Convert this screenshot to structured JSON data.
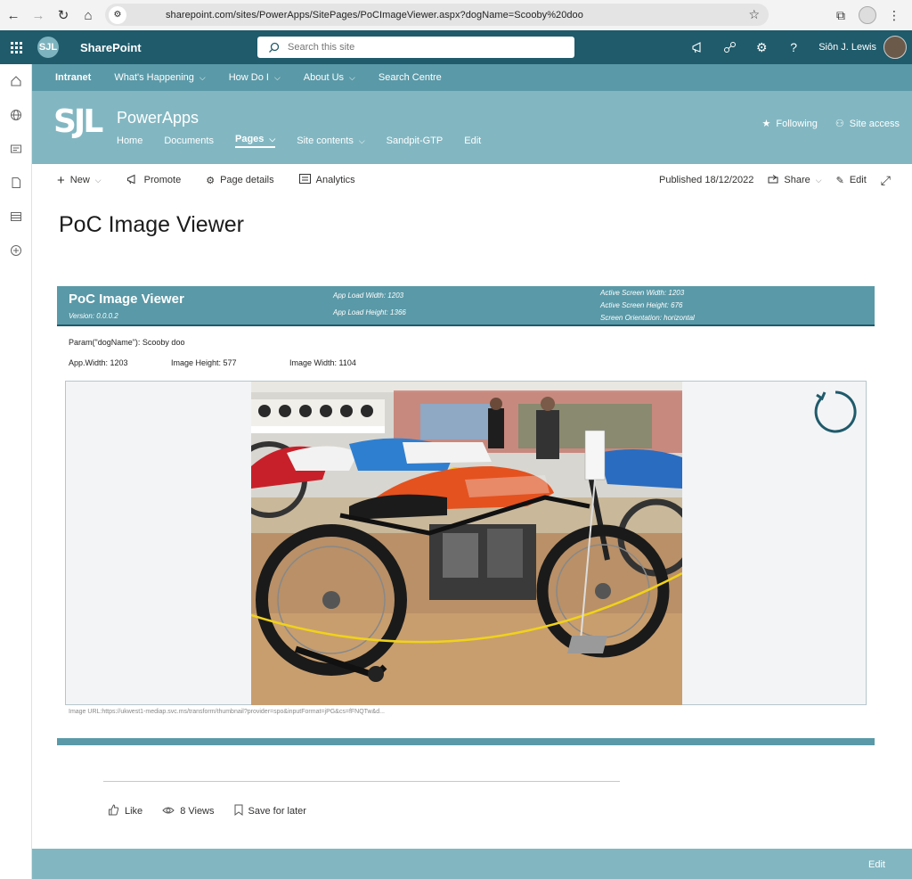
{
  "browser": {
    "url": "sharepoint.com/sites/PowerApps/SitePages/PoCImageViewer.aspx?dogName=Scooby%20doo"
  },
  "suite": {
    "app_name": "SharePoint",
    "logo_text": "SJL",
    "search_placeholder": "Search this site",
    "user_name": "Siôn J. Lewis"
  },
  "hub_nav": [
    {
      "label": "Intranet"
    },
    {
      "label": "What's Happening",
      "chevron": "⌵"
    },
    {
      "label": "How Do I",
      "chevron": "⌵"
    },
    {
      "label": "About Us",
      "chevron": "⌵"
    },
    {
      "label": "Search Centre"
    }
  ],
  "site": {
    "logo_text": "SJL",
    "title": "PowerApps",
    "nav": [
      {
        "label": "Home"
      },
      {
        "label": "Documents"
      },
      {
        "label": "Pages",
        "active": true
      },
      {
        "label": "Site contents"
      },
      {
        "label": "Sandpit-GTP"
      },
      {
        "label": "Edit"
      }
    ],
    "following_label": "Following",
    "site_access_label": "Site access"
  },
  "command_bar": {
    "new_label": "New",
    "promote_label": "Promote",
    "page_details_label": "Page details",
    "analytics_label": "Analytics",
    "published_label": "Published 18/12/2022",
    "share_label": "Share",
    "edit_label": "Edit"
  },
  "page": {
    "title": "PoC Image Viewer"
  },
  "app": {
    "title": "PoC Image Viewer",
    "version": "Version: 0.0.0.2",
    "load_width": "App Load Width: 1203",
    "load_height": "App Load Height: 1366",
    "active_width": "Active Screen Width: 1203",
    "active_height": "Active Screen Height: 676",
    "orientation": "Screen Orientation: horizontal",
    "param": "Param(\"dogName\"): Scooby doo",
    "app_width": "App.Width: 1203",
    "image_height": "Image Height: 577",
    "image_width": "Image Width: 1104",
    "image_url": "Image URL:https://ukwest1-mediap.svc.ms/transform/thumbnail?provider=spo&inputFormat=jPG&cs=fFNQTw&d..."
  },
  "social": {
    "like_label": "Like",
    "views_label": "8 Views",
    "save_label": "Save for later"
  },
  "footer": {
    "edit_label": "Edit"
  },
  "colors": {
    "suite_bar": "#1f5b6b",
    "hub_nav": "#5a99a7",
    "site_header": "#82b7c2"
  }
}
